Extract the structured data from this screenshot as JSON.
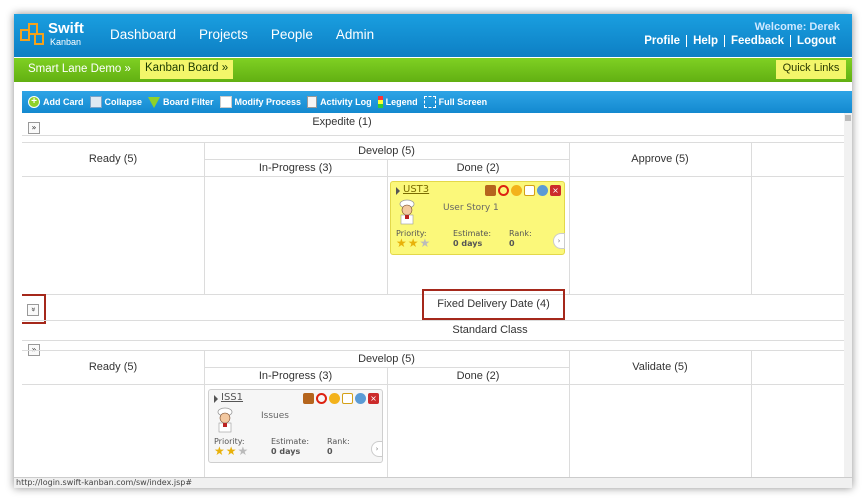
{
  "header": {
    "logo_word": "Swift",
    "logo_sub": "Kanban",
    "nav": [
      "Dashboard",
      "Projects",
      "People",
      "Admin"
    ],
    "welcome": "Welcome: Derek",
    "links": [
      "Profile",
      "Help",
      "Feedback",
      "Logout"
    ]
  },
  "breadcrumb": {
    "project": "Smart Lane Demo",
    "current": "Kanban Board",
    "quick_links": "Quick Links"
  },
  "toolbar": {
    "items": [
      "Add Card",
      "Collapse",
      "Board Filter",
      "Modify Process",
      "Activity Log",
      "Legend",
      "Full Screen"
    ]
  },
  "lanes": {
    "expedite": {
      "title": "Expedite (1)",
      "expand_glyph": "»",
      "columns": {
        "ready": "Ready (5)",
        "develop": "Develop (5)",
        "in_progress": "In-Progress (3)",
        "done": "Done (2)",
        "approve": "Approve (5)"
      },
      "card": {
        "id": "UST3",
        "title": "User Story 1",
        "priority_label": "Priority:",
        "estimate_label": "Estimate:",
        "estimate_value": "0 days",
        "rank_label": "Rank:",
        "rank_value": "0",
        "priority_stars": 3,
        "color": "#fbf87a"
      }
    },
    "fixed_delivery": {
      "title": "Fixed Delivery Date (4)",
      "expand_glyph": "»"
    },
    "standard": {
      "title": "Standard Class",
      "expand_glyph": "»",
      "columns": {
        "ready": "Ready (5)",
        "develop": "Develop (5)",
        "in_progress": "In-Progress (3)",
        "done": "Done (2)",
        "validate": "Validate (5)"
      },
      "card": {
        "id": "ISS1",
        "title": "Issues",
        "priority_label": "Priority:",
        "estimate_label": "Estimate:",
        "estimate_value": "0 days",
        "rank_label": "Rank:",
        "rank_value": "0",
        "priority_stars": 3,
        "color": "#f6f6f6"
      }
    }
  },
  "status_bar": "http://login.swift-kanban.com/sw/index.jsp#",
  "colors": {
    "header_blue": "#1389cf",
    "green_bar": "#6fc01a",
    "highlight_red": "#a5281b"
  }
}
